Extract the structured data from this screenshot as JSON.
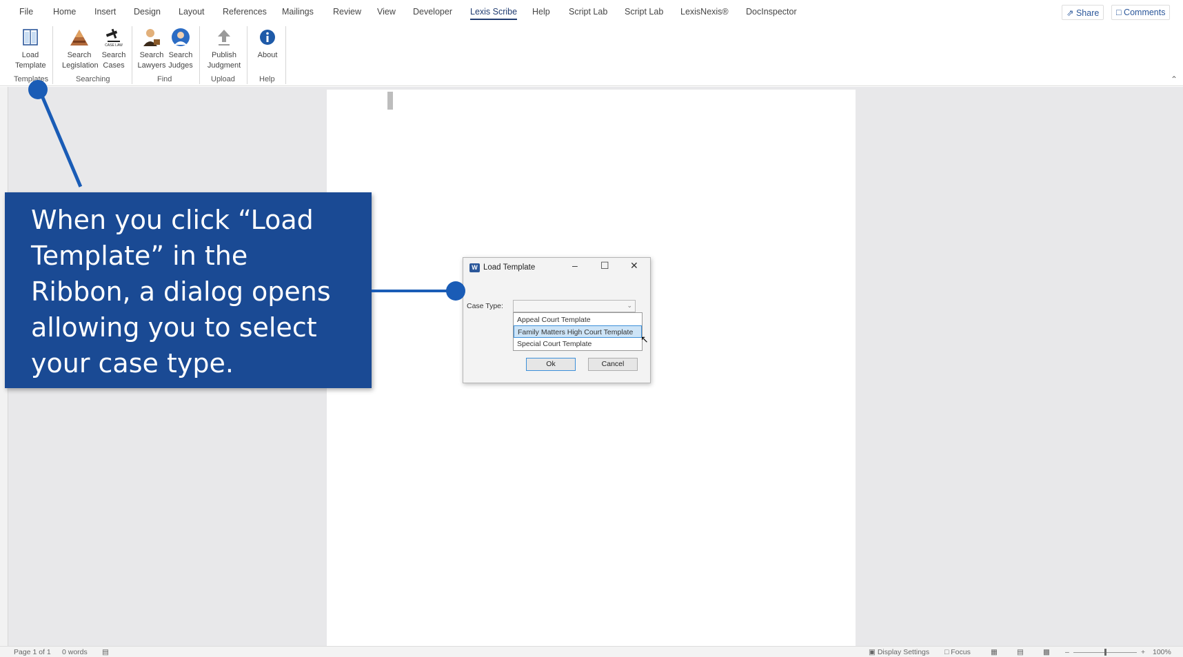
{
  "menu": {
    "tabs": [
      "File",
      "Home",
      "Insert",
      "Design",
      "Layout",
      "References",
      "Mailings",
      "Review",
      "View",
      "Developer",
      "Lexis Scribe",
      "Help",
      "Script Lab",
      "Script Lab",
      "LexisNexis®",
      "DocInspector"
    ],
    "active_tab": "Lexis Scribe",
    "share": "Share",
    "comments": "Comments"
  },
  "ribbon": {
    "load_template": [
      "Load",
      "Template"
    ],
    "search_legislation": [
      "Search",
      "Legislation"
    ],
    "search_cases": [
      "Search",
      "Cases"
    ],
    "search_lawyers": [
      "Search",
      "Lawyers"
    ],
    "search_judges": [
      "Search",
      "Judges"
    ],
    "publish_judgment": [
      "Publish",
      "Judgment"
    ],
    "about": "About",
    "case_law_badge": "CASE LAW",
    "groups": {
      "templates": "Templates",
      "searching": "Searching",
      "find": "Find",
      "upload": "Upload",
      "help": "Help"
    }
  },
  "dialog": {
    "title": "Load Template",
    "case_type_label": "Case Type:",
    "options": [
      "Appeal Court Template",
      "Family Matters High Court Template",
      "Special Court Template"
    ],
    "highlighted_option": "Family Matters High Court Template",
    "ok": "Ok",
    "cancel": "Cancel"
  },
  "callout": {
    "text": "When you click “Load Template” in the Ribbon, a dialog opens allowing you to select your case type."
  },
  "status": {
    "page": "Page 1 of 1",
    "words": "0 words",
    "display_settings": "Display Settings",
    "focus": "Focus",
    "zoom": "100%"
  },
  "colors": {
    "callout_bg": "#1a4a94",
    "accent": "#1a5cb6",
    "word_blue": "#2b579a"
  }
}
